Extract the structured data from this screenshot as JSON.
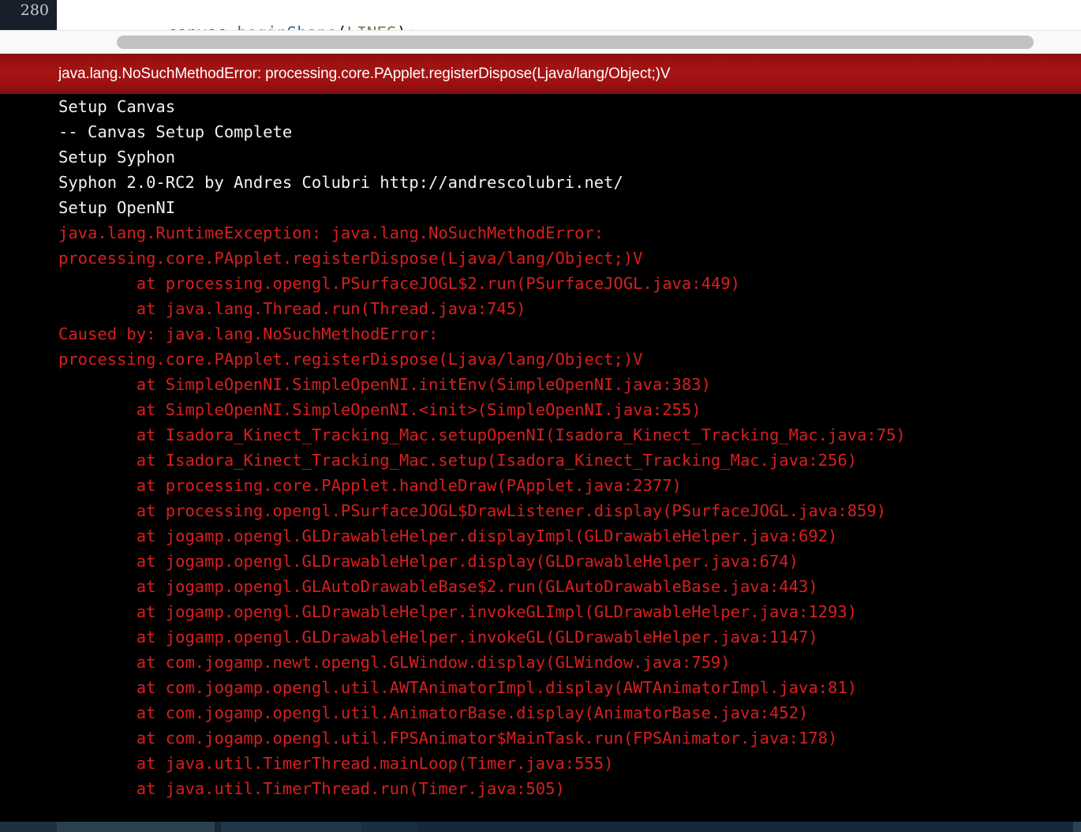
{
  "editor": {
    "line_number": "280",
    "code_tokens": [
      {
        "text": "canvas.",
        "type": "plain"
      },
      {
        "text": "beginShape",
        "type": "method"
      },
      {
        "text": "(",
        "type": "punct"
      },
      {
        "text": "LINES",
        "type": "const"
      },
      {
        "text": ");",
        "type": "punct"
      }
    ],
    "code_text": "canvas.beginShape(LINES);"
  },
  "scrollbar": {
    "orientation": "horizontal",
    "thumb_position_percent": 11,
    "thumb_width_percent": 85
  },
  "error_banner": {
    "message": "java.lang.NoSuchMethodError: processing.core.PApplet.registerDispose(Ljava/lang/Object;)V",
    "background_color": "#a81313",
    "text_color": "#ffffff"
  },
  "console": {
    "background_color": "#000000",
    "stdout_color": "#f2f2f2",
    "stderr_color": "#d81f1f",
    "lines": [
      {
        "text": "Setup Canvas",
        "stream": "out"
      },
      {
        "text": "-- Canvas Setup Complete",
        "stream": "out"
      },
      {
        "text": "Setup Syphon",
        "stream": "out"
      },
      {
        "text": "Syphon 2.0-RC2 by Andres Colubri http://andrescolubri.net/",
        "stream": "out"
      },
      {
        "text": "Setup OpenNI",
        "stream": "out"
      },
      {
        "text": "java.lang.RuntimeException: java.lang.NoSuchMethodError:",
        "stream": "err"
      },
      {
        "text": "processing.core.PApplet.registerDispose(Ljava/lang/Object;)V",
        "stream": "err"
      },
      {
        "text": "        at processing.opengl.PSurfaceJOGL$2.run(PSurfaceJOGL.java:449)",
        "stream": "err"
      },
      {
        "text": "        at java.lang.Thread.run(Thread.java:745)",
        "stream": "err"
      },
      {
        "text": "Caused by: java.lang.NoSuchMethodError:",
        "stream": "err"
      },
      {
        "text": "processing.core.PApplet.registerDispose(Ljava/lang/Object;)V",
        "stream": "err"
      },
      {
        "text": "        at SimpleOpenNI.SimpleOpenNI.initEnv(SimpleOpenNI.java:383)",
        "stream": "err"
      },
      {
        "text": "        at SimpleOpenNI.SimpleOpenNI.<init>(SimpleOpenNI.java:255)",
        "stream": "err"
      },
      {
        "text": "        at Isadora_Kinect_Tracking_Mac.setupOpenNI(Isadora_Kinect_Tracking_Mac.java:75)",
        "stream": "err"
      },
      {
        "text": "        at Isadora_Kinect_Tracking_Mac.setup(Isadora_Kinect_Tracking_Mac.java:256)",
        "stream": "err"
      },
      {
        "text": "        at processing.core.PApplet.handleDraw(PApplet.java:2377)",
        "stream": "err"
      },
      {
        "text": "        at processing.opengl.PSurfaceJOGL$DrawListener.display(PSurfaceJOGL.java:859)",
        "stream": "err"
      },
      {
        "text": "        at jogamp.opengl.GLDrawableHelper.displayImpl(GLDrawableHelper.java:692)",
        "stream": "err"
      },
      {
        "text": "        at jogamp.opengl.GLDrawableHelper.display(GLDrawableHelper.java:674)",
        "stream": "err"
      },
      {
        "text": "        at jogamp.opengl.GLAutoDrawableBase$2.run(GLAutoDrawableBase.java:443)",
        "stream": "err"
      },
      {
        "text": "        at jogamp.opengl.GLDrawableHelper.invokeGLImpl(GLDrawableHelper.java:1293)",
        "stream": "err"
      },
      {
        "text": "        at jogamp.opengl.GLDrawableHelper.invokeGL(GLDrawableHelper.java:1147)",
        "stream": "err"
      },
      {
        "text": "        at com.jogamp.newt.opengl.GLWindow.display(GLWindow.java:759)",
        "stream": "err"
      },
      {
        "text": "        at com.jogamp.opengl.util.AWTAnimatorImpl.display(AWTAnimatorImpl.java:81)",
        "stream": "err"
      },
      {
        "text": "        at com.jogamp.opengl.util.AnimatorBase.display(AnimatorBase.java:452)",
        "stream": "err"
      },
      {
        "text": "        at com.jogamp.opengl.util.FPSAnimator$MainTask.run(FPSAnimator.java:178)",
        "stream": "err"
      },
      {
        "text": "        at java.util.TimerThread.mainLoop(Timer.java:555)",
        "stream": "err"
      },
      {
        "text": "        at java.util.TimerThread.run(Timer.java:505)",
        "stream": "err"
      }
    ]
  },
  "taskbar": {
    "background_color": "#16293a"
  }
}
